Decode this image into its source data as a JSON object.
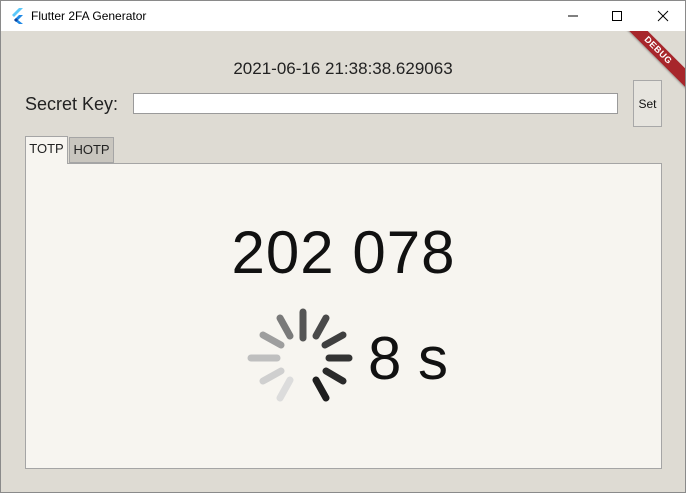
{
  "window": {
    "title": "Flutter 2FA Generator"
  },
  "debug_banner": "DEBUG",
  "datetime": "2021-06-16 21:38:38.629063",
  "secret": {
    "label": "Secret Key:",
    "value": "",
    "placeholder": ""
  },
  "set_button": "Set",
  "tabs": [
    {
      "label": "TOTP",
      "selected": true
    },
    {
      "label": "HOTP",
      "selected": false
    }
  ],
  "otp": {
    "code": "202 078",
    "countdown": "8 s"
  },
  "colors": {
    "window_bg": "#dedbd3",
    "panel_bg": "#f7f5f0",
    "debug_banner": "#a7262b",
    "flutter_blue": "#42a5f5"
  },
  "icons": [
    "flutter-logo-icon",
    "minimize-icon",
    "maximize-icon",
    "close-icon",
    "loading-spinner-icon"
  ]
}
